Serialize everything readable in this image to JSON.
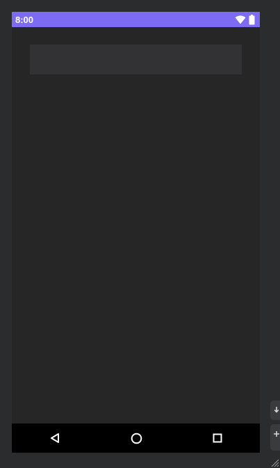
{
  "status_bar": {
    "time": "8:00",
    "icons": [
      "wifi-icon",
      "battery-icon"
    ],
    "accent_color": "#7c6bf3"
  },
  "navigation_bar": {
    "buttons": [
      "back-icon",
      "home-icon",
      "recents-icon"
    ]
  },
  "theme": {
    "screen_background": "#262626",
    "workspace_background": "#2b2c2e",
    "top_bar_background": "#323235",
    "nav_background": "#000000"
  }
}
